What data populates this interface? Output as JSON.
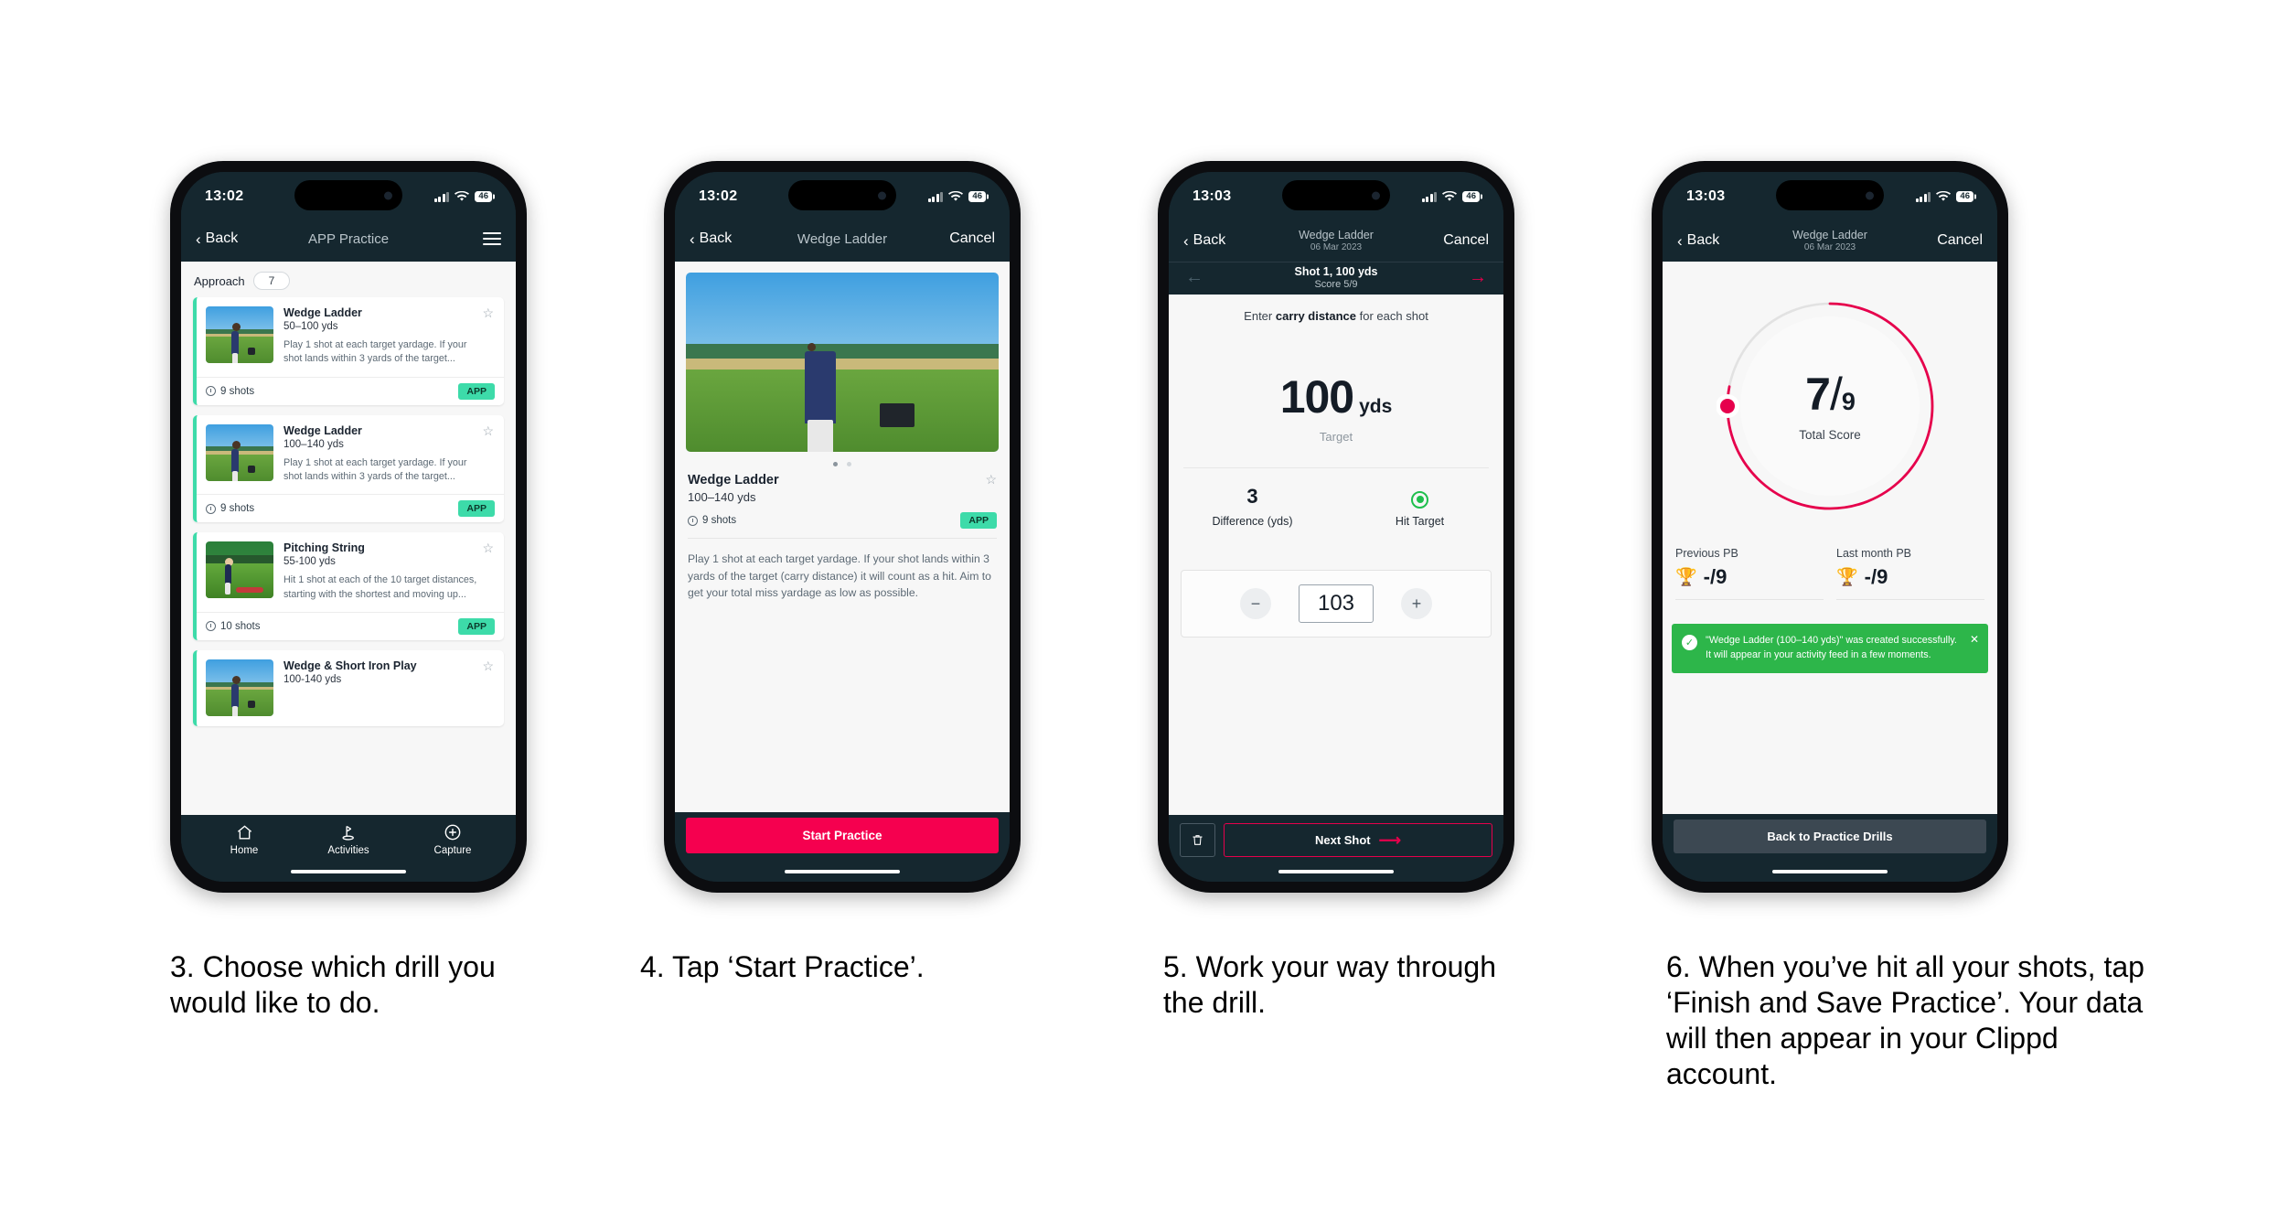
{
  "phones": [
    {
      "id": "phone-practice-list",
      "status": {
        "time": "13:02",
        "battery": "46"
      },
      "nav": {
        "back": "Back",
        "title": "APP Practice"
      },
      "filter": {
        "label": "Approach",
        "count": "7"
      },
      "drills": [
        {
          "title": "Wedge Ladder",
          "yards": "50–100 yds",
          "desc": "Play 1 shot at each target yardage. If your shot lands within 3 yards of the target...",
          "shots": "9 shots",
          "tag": "APP"
        },
        {
          "title": "Wedge Ladder",
          "yards": "100–140 yds",
          "desc": "Play 1 shot at each target yardage. If your shot lands within 3 yards of the target...",
          "shots": "9 shots",
          "tag": "APP"
        },
        {
          "title": "Pitching String",
          "yards": "55-100 yds",
          "desc": "Hit 1 shot at each of the 10 target distances, starting with the shortest and moving up...",
          "shots": "10 shots",
          "tag": "APP"
        },
        {
          "title": "Wedge & Short Iron Play",
          "yards": "100-140 yds",
          "desc": "",
          "shots": "",
          "tag": ""
        }
      ],
      "tabs": [
        {
          "label": "Home",
          "icon": "home-icon"
        },
        {
          "label": "Activities",
          "icon": "golf-flag-icon"
        },
        {
          "label": "Capture",
          "icon": "plus-circle-icon"
        }
      ]
    },
    {
      "id": "phone-drill-detail",
      "status": {
        "time": "13:02",
        "battery": "46"
      },
      "nav": {
        "back": "Back",
        "title": "Wedge Ladder",
        "cancel": "Cancel"
      },
      "detail": {
        "title": "Wedge Ladder",
        "yards": "100–140 yds",
        "shots": "9 shots",
        "tag": "APP",
        "desc": "Play 1 shot at each target yardage. If your shot lands within 3 yards of the target (carry distance) it will count as a hit. Aim to get your total miss yardage as low as possible."
      },
      "cta": "Start Practice"
    },
    {
      "id": "phone-shot-entry",
      "status": {
        "time": "13:03",
        "battery": "46"
      },
      "nav": {
        "back": "Back",
        "title": "Wedge Ladder",
        "subtitle": "06 Mar 2023",
        "cancel": "Cancel"
      },
      "shotbar": {
        "title": "Shot 1, 100 yds",
        "score": "Score 5/9"
      },
      "hint_pre": "Enter ",
      "hint_bold": "carry distance",
      "hint_post": " for each shot",
      "target": {
        "value": "100",
        "unit": "yds",
        "label": "Target"
      },
      "stats": [
        {
          "value": "3",
          "label": "Difference (yds)"
        },
        {
          "value": "",
          "label": "Hit Target"
        }
      ],
      "stepper": {
        "minus": "−",
        "value": "103",
        "plus": "+"
      },
      "next": "Next Shot"
    },
    {
      "id": "phone-summary",
      "status": {
        "time": "13:03",
        "battery": "46"
      },
      "nav": {
        "back": "Back",
        "title": "Wedge Ladder",
        "subtitle": "06 Mar 2023",
        "cancel": "Cancel"
      },
      "ring": {
        "score": "7",
        "slash": "/",
        "denominator": "9",
        "label": "Total Score",
        "percent": 78
      },
      "pbs": [
        {
          "label": "Previous PB",
          "value": "-/9"
        },
        {
          "label": "Last month PB",
          "value": "-/9"
        }
      ],
      "toast": {
        "message": "\"Wedge Ladder (100–140 yds)\" was created successfully. It will appear in your activity feed in a few moments.",
        "close": "✕"
      },
      "bottom_button": "Back to Practice Drills"
    }
  ],
  "captions": [
    "3. Choose which drill you would like to do.",
    "4. Tap ‘Start Practice’.",
    "5. Work your way through the drill.",
    "6. When you’ve hit all your shots, tap ‘Finish and Save Practice’. Your data will then appear in your Clippd account."
  ],
  "colors": {
    "nav_dark": "#15272f",
    "accent_pink": "#f5004f",
    "accent_teal": "#3ddba9",
    "toast_green": "#2db64a",
    "ring_pink": "#e6004c"
  }
}
